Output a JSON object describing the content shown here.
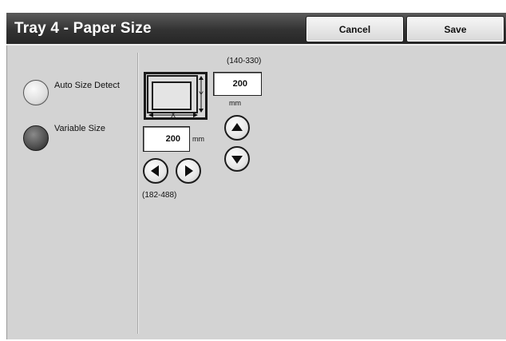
{
  "header": {
    "title": "Tray 4 - Paper Size",
    "cancel_label": "Cancel",
    "save_label": "Save"
  },
  "options": {
    "auto_label": "Auto Size Detect",
    "variable_label": "Variable Size",
    "selected": "Variable Size"
  },
  "size": {
    "y_range": "(140-330)",
    "y_value": "200",
    "y_unit": "mm",
    "x_range": "(182-488)",
    "x_value": "200",
    "x_unit": "mm"
  },
  "icons": {
    "paper": "paper-size-diagram-icon",
    "up": "up-arrow-icon",
    "down": "down-arrow-icon",
    "left": "left-arrow-icon",
    "right": "right-arrow-icon"
  },
  "colors": {
    "panel": "#d3d3d3",
    "title_bar": "#333333"
  }
}
